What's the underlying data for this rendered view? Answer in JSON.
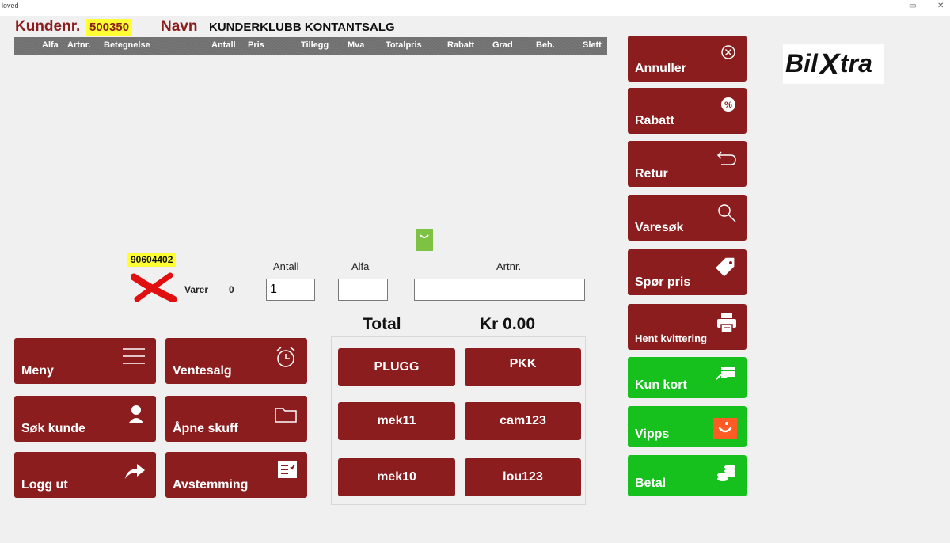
{
  "window": {
    "title": "loved",
    "controls": [
      "▭",
      "✕"
    ]
  },
  "header": {
    "customer_label": "Kundenr.",
    "customer_number": "500350",
    "name_label": "Navn",
    "name_value": "KUNDERKLUBB KONTANTSALG"
  },
  "columns": [
    "Alfa",
    "Artnr.",
    "Betegnelse",
    "Antall",
    "Pris",
    "Tillegg",
    "Mva",
    "Totalpris",
    "Rabatt",
    "Grad",
    "Beh.",
    "Slett"
  ],
  "entry": {
    "barcode": "90604402",
    "items_label": "Varer",
    "items_count": "0",
    "quantity_label": "Antall",
    "quantity_value": "1",
    "alfa_label": "Alfa",
    "alfa_value": "",
    "artnr_label": "Artnr.",
    "artnr_value": ""
  },
  "total": {
    "label": "Total",
    "amount": "Kr 0.00"
  },
  "left_buttons": [
    {
      "label": "Meny",
      "icon": "menu-icon"
    },
    {
      "label": "Ventesalg",
      "icon": "alarm-clock-icon"
    },
    {
      "label": "Søk kunde",
      "icon": "person-icon"
    },
    {
      "label": "Åpne skuff",
      "icon": "folder-icon"
    },
    {
      "label": "Logg ut",
      "icon": "share-arrow-icon"
    },
    {
      "label": "Avstemming",
      "icon": "checklist-icon"
    }
  ],
  "quick_buttons": [
    "PLUGG",
    "PKK",
    "mek11",
    "cam123",
    "mek10",
    "lou123"
  ],
  "right_buttons": [
    {
      "label": "Annuller",
      "icon": "cancel-circle-icon"
    },
    {
      "label": "Rabatt",
      "icon": "percent-badge-icon"
    },
    {
      "label": "Retur",
      "icon": "return-arrow-icon"
    },
    {
      "label": "Varesøk",
      "icon": "magnifier-icon"
    },
    {
      "label": "Spør pris",
      "icon": "price-tag-icon"
    },
    {
      "label": "Hent kvittering",
      "icon": "printer-icon"
    },
    {
      "label": "Kun kort",
      "icon": "card-payment-icon"
    },
    {
      "label": "Vipps",
      "icon": "vipps-icon"
    },
    {
      "label": "Betal",
      "icon": "coins-icon"
    }
  ],
  "brand": {
    "logo_text": "BilXtra",
    "logo_parts": [
      "Bil",
      "X",
      "tra"
    ],
    "accent": "#8b1d1f",
    "green": "#16c11e"
  }
}
